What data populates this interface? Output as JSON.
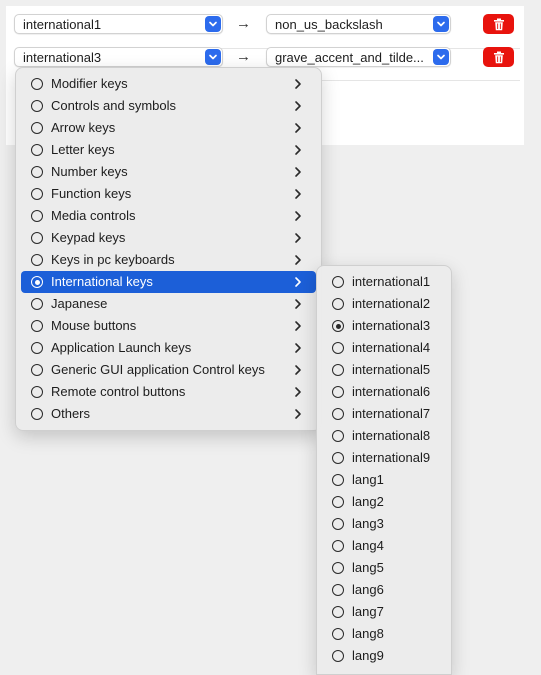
{
  "rows": [
    {
      "from": "international1",
      "to": "non_us_backslash"
    },
    {
      "from": "international3",
      "to": "grave_accent_and_tilde..."
    }
  ],
  "arrow_glyph": "→",
  "main_menu": {
    "items": [
      {
        "label": "Modifier keys"
      },
      {
        "label": "Controls and symbols"
      },
      {
        "label": "Arrow keys"
      },
      {
        "label": "Letter keys"
      },
      {
        "label": "Number keys"
      },
      {
        "label": "Function keys"
      },
      {
        "label": "Media controls"
      },
      {
        "label": "Keypad keys"
      },
      {
        "label": "Keys in pc keyboards"
      },
      {
        "label": "International keys",
        "highlighted": true,
        "selected": true
      },
      {
        "label": "Japanese"
      },
      {
        "label": "Mouse buttons"
      },
      {
        "label": "Application Launch keys"
      },
      {
        "label": "Generic GUI application Control keys"
      },
      {
        "label": "Remote control buttons"
      },
      {
        "label": "Others"
      }
    ]
  },
  "sub_menu": {
    "items": [
      {
        "label": "international1"
      },
      {
        "label": "international2"
      },
      {
        "label": "international3",
        "selected": true
      },
      {
        "label": "international4"
      },
      {
        "label": "international5"
      },
      {
        "label": "international6"
      },
      {
        "label": "international7"
      },
      {
        "label": "international8"
      },
      {
        "label": "international9"
      },
      {
        "label": "lang1"
      },
      {
        "label": "lang2"
      },
      {
        "label": "lang3"
      },
      {
        "label": "lang4"
      },
      {
        "label": "lang5"
      },
      {
        "label": "lang6"
      },
      {
        "label": "lang7"
      },
      {
        "label": "lang8"
      },
      {
        "label": "lang9"
      }
    ]
  },
  "colors": {
    "accent": "#2c6bed",
    "highlight": "#1c5fd8",
    "delete": "#e8130d"
  }
}
